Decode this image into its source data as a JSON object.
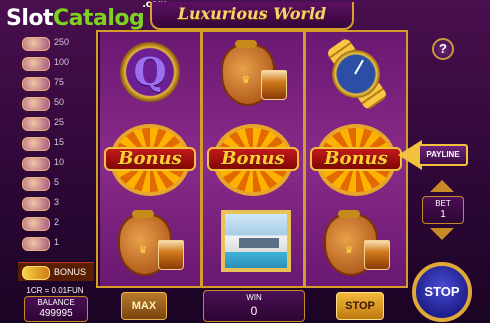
{
  "watermark": {
    "part1": "Slot",
    "part2": "Catalog",
    "suffix": ".com"
  },
  "game": {
    "title": "Luxurious World"
  },
  "paytable": {
    "rows": [
      "250",
      "100",
      "75",
      "50",
      "25",
      "15",
      "10",
      "5",
      "3",
      "2",
      "1"
    ],
    "bonus_label": "BONUS"
  },
  "reels": [
    {
      "symbols": [
        "q-symbol",
        "bonus-wheel",
        "cognac-bag"
      ]
    },
    {
      "symbols": [
        "cognac-bag",
        "bonus-wheel",
        "villa-picture"
      ]
    },
    {
      "symbols": [
        "gold-watch",
        "bonus-wheel",
        "cognac-bag"
      ]
    }
  ],
  "symbols": {
    "q_letter": "Q",
    "bonus_text": "Bonus"
  },
  "payline": {
    "label": "PAYLINE"
  },
  "help": {
    "label": "?"
  },
  "bet": {
    "label": "BET",
    "value": "1"
  },
  "footer": {
    "coin_rate": "1CR = 0.01FUN",
    "balance_label": "BALANCE",
    "balance_value": "499995",
    "max_label": "MAX",
    "win_label": "WIN",
    "win_value": "0",
    "stop_label": "STOP",
    "big_stop_label": "STOP"
  },
  "colors": {
    "gold": "#d69c2a",
    "purple": "#4a0f4e",
    "bonus_red": "#c21a1a",
    "stop_blue": "#2a2cb8"
  }
}
